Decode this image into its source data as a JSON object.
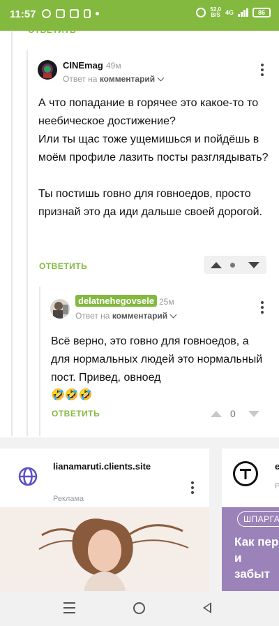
{
  "status_bar": {
    "time": "11:57",
    "net_speed_value": "52,0",
    "net_speed_unit": "B/S",
    "network_type": "4G",
    "battery": "86"
  },
  "comments": [
    {
      "author": "CINEmag",
      "time": "49м",
      "reply_prefix": "Ответ на",
      "reply_target": "комментарий",
      "body": "А что попадание в горячее это какое-то то неебическое достижение?\nИли ты щас тоже ущемишься и пойдёшь в моём профиле лазить посты разглядывать?\n\nТы постишь говно для говноедов, просто признай это да иди дальше своей дорогой.",
      "reply_label": "ОТВЕТИТЬ"
    },
    {
      "author": "delatnehegovsele",
      "time": "25м",
      "reply_prefix": "Ответ на",
      "reply_target": "комментарий",
      "body": "Всё верно, это говно для говноедов, а для нормальных людей это нормальный пост. Привед, овноед",
      "emoji": "🤣🤣🤣",
      "reply_label": "ОТВЕТИТЬ",
      "vote_count": "0"
    }
  ],
  "ads": [
    {
      "site": "lianamaruti.clients.site",
      "label": "Реклама",
      "icon": "globe-icon"
    },
    {
      "site": "e",
      "label": "Р",
      "icon": "t-logo-icon",
      "tag": "ШПАРГА",
      "headline": "Как пер\nи забыт"
    }
  ],
  "colors": {
    "accent": "#83b93f",
    "ad_purple": "#5b4fc9",
    "ad_banner": "#9b82b8"
  },
  "nav": {
    "menu_icon": "menu-icon",
    "home_icon": "home-icon",
    "back_icon": "back-icon"
  }
}
